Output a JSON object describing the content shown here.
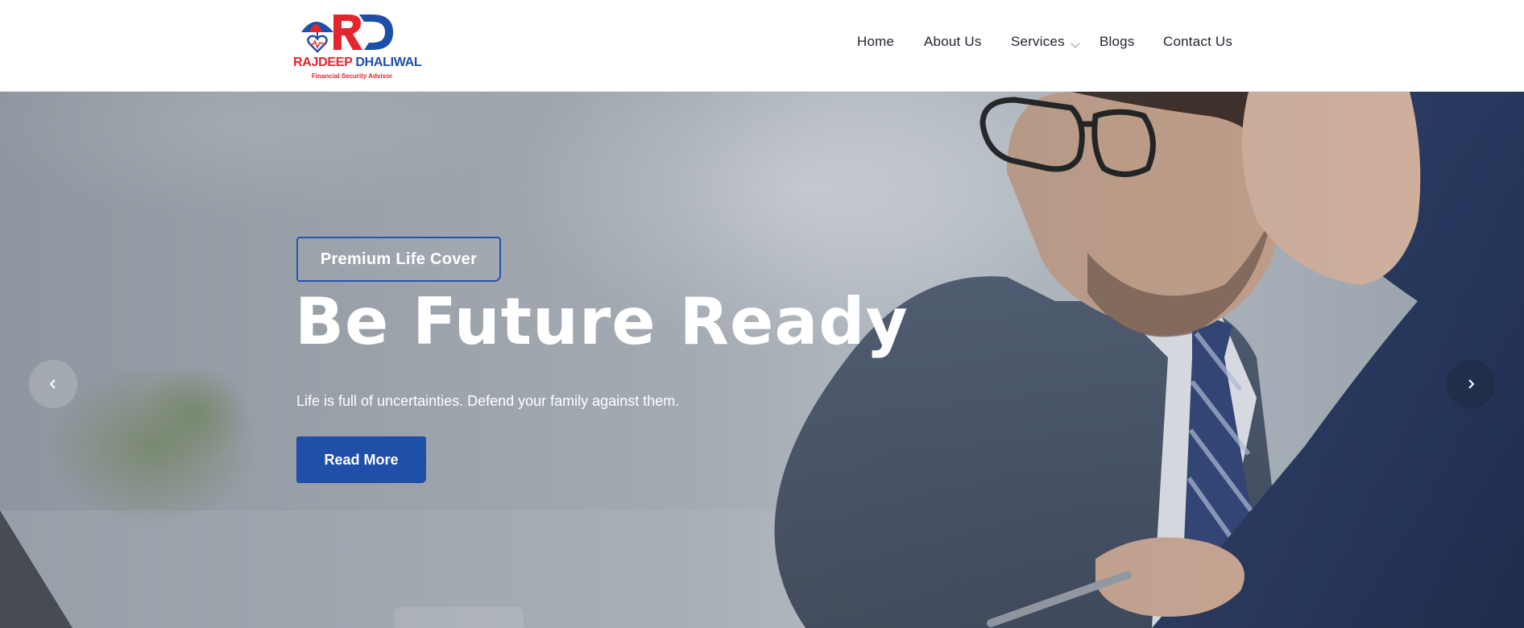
{
  "brand": {
    "name_part1": "RAJDEEP",
    "name_part2": "DHALIWAL",
    "tagline": "Financial Security Advisor",
    "primary_color": "#1e4fa8",
    "accent_color": "#e3262d"
  },
  "nav": {
    "items": [
      {
        "label": "Home"
      },
      {
        "label": "About Us"
      },
      {
        "label": "Services",
        "has_dropdown": true
      },
      {
        "label": "Blogs"
      },
      {
        "label": "Contact Us"
      }
    ]
  },
  "hero": {
    "badge": "Premium Life Cover",
    "title": "Be Future Ready",
    "subtitle": "Life is full of uncertainties. Defend your family against them.",
    "cta_label": "Read More",
    "prev_icon": "chevron-left-icon",
    "next_icon": "chevron-right-icon"
  }
}
